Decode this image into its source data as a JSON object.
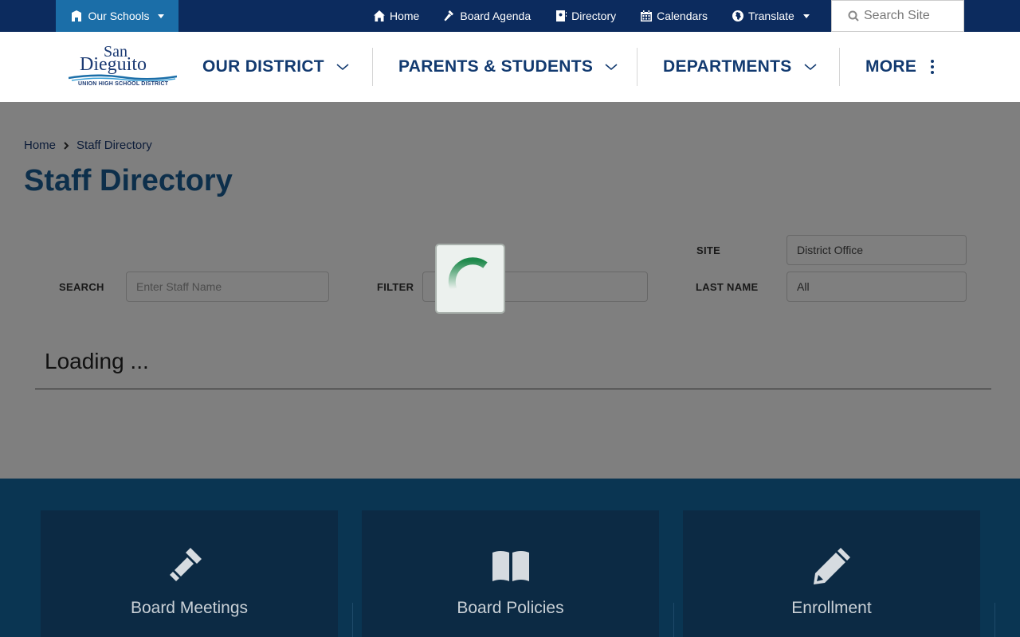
{
  "utility_bar": {
    "our_schools": "Our Schools",
    "links": [
      {
        "label": "Home",
        "icon": "home-icon"
      },
      {
        "label": "Board Agenda",
        "icon": "gavel-icon"
      },
      {
        "label": "Directory",
        "icon": "contact-book-icon"
      },
      {
        "label": "Calendars",
        "icon": "calendar-icon"
      },
      {
        "label": "Translate",
        "icon": "globe-icon"
      }
    ],
    "search_placeholder": "Search Site"
  },
  "logo": {
    "line1": "San",
    "line2": "Dieguito",
    "line3": "UNION HIGH SCHOOL DISTRICT"
  },
  "nav": {
    "items": [
      "OUR DISTRICT",
      "PARENTS & STUDENTS",
      "DEPARTMENTS",
      "MORE"
    ]
  },
  "breadcrumb": {
    "home": "Home",
    "current": "Staff Directory"
  },
  "page": {
    "title": "Staff Directory"
  },
  "filters": {
    "search_label": "SEARCH",
    "search_placeholder": "Enter Staff Name",
    "filter_label": "FILTER",
    "site_label": "SITE",
    "site_value": "District Office",
    "last_name_label": "LAST NAME",
    "last_name_value": "All"
  },
  "status": {
    "loading": "Loading ..."
  },
  "colors": {
    "utility_bar": "#0c2b5e",
    "our_schools": "#1b6ea8",
    "nav_text": "#123a70",
    "title": "#1b5e96",
    "spinner": "#1f8a4c",
    "footer": "#0a3552"
  },
  "footer": {
    "cards": [
      {
        "label": "Board Meetings",
        "icon": "gavel-icon"
      },
      {
        "label": "Board Policies",
        "icon": "open-book-icon"
      },
      {
        "label": "Enrollment",
        "icon": "pencil-icon"
      }
    ]
  }
}
